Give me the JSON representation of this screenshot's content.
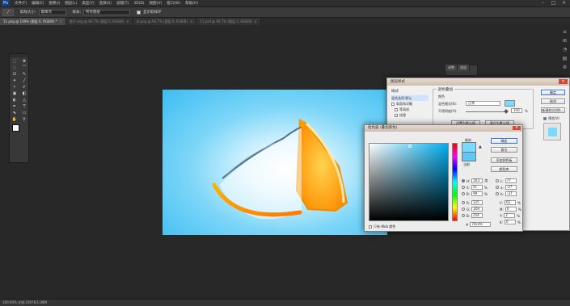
{
  "app": {
    "logo": "Ps"
  },
  "menu": [
    "文件(F)",
    "编辑(E)",
    "图像(I)",
    "图层(L)",
    "类型(Y)",
    "选择(S)",
    "滤镜(T)",
    "3D(D)",
    "视图(V)",
    "窗口(W)",
    "帮助(H)"
  ],
  "window_controls": {
    "minimize": "–",
    "maximize": "□",
    "close": "×"
  },
  "options": {
    "tool_glyph": "⁄",
    "sample_size_label": "取样大小:",
    "sample_size_value": "取样点",
    "sample_label": "样本:",
    "sample_value": "所有图层",
    "show_ring_label": "显示取样环"
  },
  "doc_tabs": [
    {
      "label": "11.png @ 100% (图层 0, RGB/8) *",
      "active": true
    },
    {
      "label": "橙子.png @ 66.7% (图层 0, RGB/8)",
      "active": false
    },
    {
      "label": "水.png @ 66.7% (图层 0, RGB/8)",
      "active": false
    },
    {
      "label": "11.psd @ 66.7% (图层 2, RGB/8)",
      "active": false
    }
  ],
  "tools": [
    "⬚",
    "✥",
    "◌",
    "⌒",
    "⊡",
    "✎",
    "✦",
    "╱",
    "⚕",
    "✐",
    "▣",
    "◧",
    "◐",
    "△",
    "✒",
    "T",
    "⬉",
    "▭",
    "✋",
    "⚲"
  ],
  "panels": {
    "tabs": [
      "调整",
      "通道"
    ]
  },
  "dock_icons": [
    "≡",
    "⊞",
    "◔",
    "▤",
    "⚙"
  ],
  "layer_style": {
    "title": "图层样式",
    "styles_heading": "样式",
    "blend_defaults": "混合选项:默认",
    "items": [
      {
        "label": "斜面和浮雕",
        "checked": false
      },
      {
        "label": "等高线",
        "checked": false
      },
      {
        "label": "纹理",
        "checked": false
      }
    ],
    "group_title": "颜色叠加",
    "sub_title": "颜色",
    "blend_mode_label": "混合模式(B):",
    "blend_mode_value": "正常",
    "opacity_label": "不透明度(O):",
    "opacity_value": "100",
    "opacity_unit": "%",
    "set_default": "设置为默认值",
    "reset_default": "复位为默认值",
    "ok": "确定",
    "cancel": "取消",
    "new_style": "新建样式(W)...",
    "preview_label": "预览(V)",
    "overlay_color": "#7ad9ff"
  },
  "picker": {
    "title": "拾色器 (叠加颜色)",
    "new_label": "新的",
    "current_label": "当前",
    "ok": "确定",
    "cancel": "复位",
    "add_swatch": "添加到色板",
    "libraries": "颜色库",
    "fields": [
      {
        "label": "H:",
        "value": "203",
        "unit": "度",
        "on": true
      },
      {
        "label": "S:",
        "value": "51",
        "unit": "%",
        "on": false
      },
      {
        "label": "B:",
        "value": "99",
        "unit": "%",
        "on": false
      },
      {
        "label": "R:",
        "value": "125",
        "unit": "",
        "on": false
      },
      {
        "label": "G:",
        "value": "204",
        "unit": "",
        "on": false
      },
      {
        "label": "B:",
        "value": "254",
        "unit": "",
        "on": false
      }
    ],
    "lab_fields": [
      {
        "label": "L:",
        "value": "77",
        "unit": ""
      },
      {
        "label": "a:",
        "value": "-27",
        "unit": ""
      },
      {
        "label": "b:",
        "value": "-37",
        "unit": ""
      },
      {
        "label": "C:",
        "value": "62",
        "unit": "%"
      },
      {
        "label": "M:",
        "value": "0",
        "unit": "%"
      },
      {
        "label": "Y:",
        "value": "2",
        "unit": "%"
      },
      {
        "label": "K:",
        "value": "0",
        "unit": "%"
      }
    ],
    "hex_prefix": "#",
    "hex": "7dccfe",
    "web_only": "只有 Web 颜色",
    "new_color": "#7ad9ff",
    "current_color": "#5cc8f4"
  },
  "status": {
    "text": "100.00%  文档:1007K/1.08M"
  }
}
